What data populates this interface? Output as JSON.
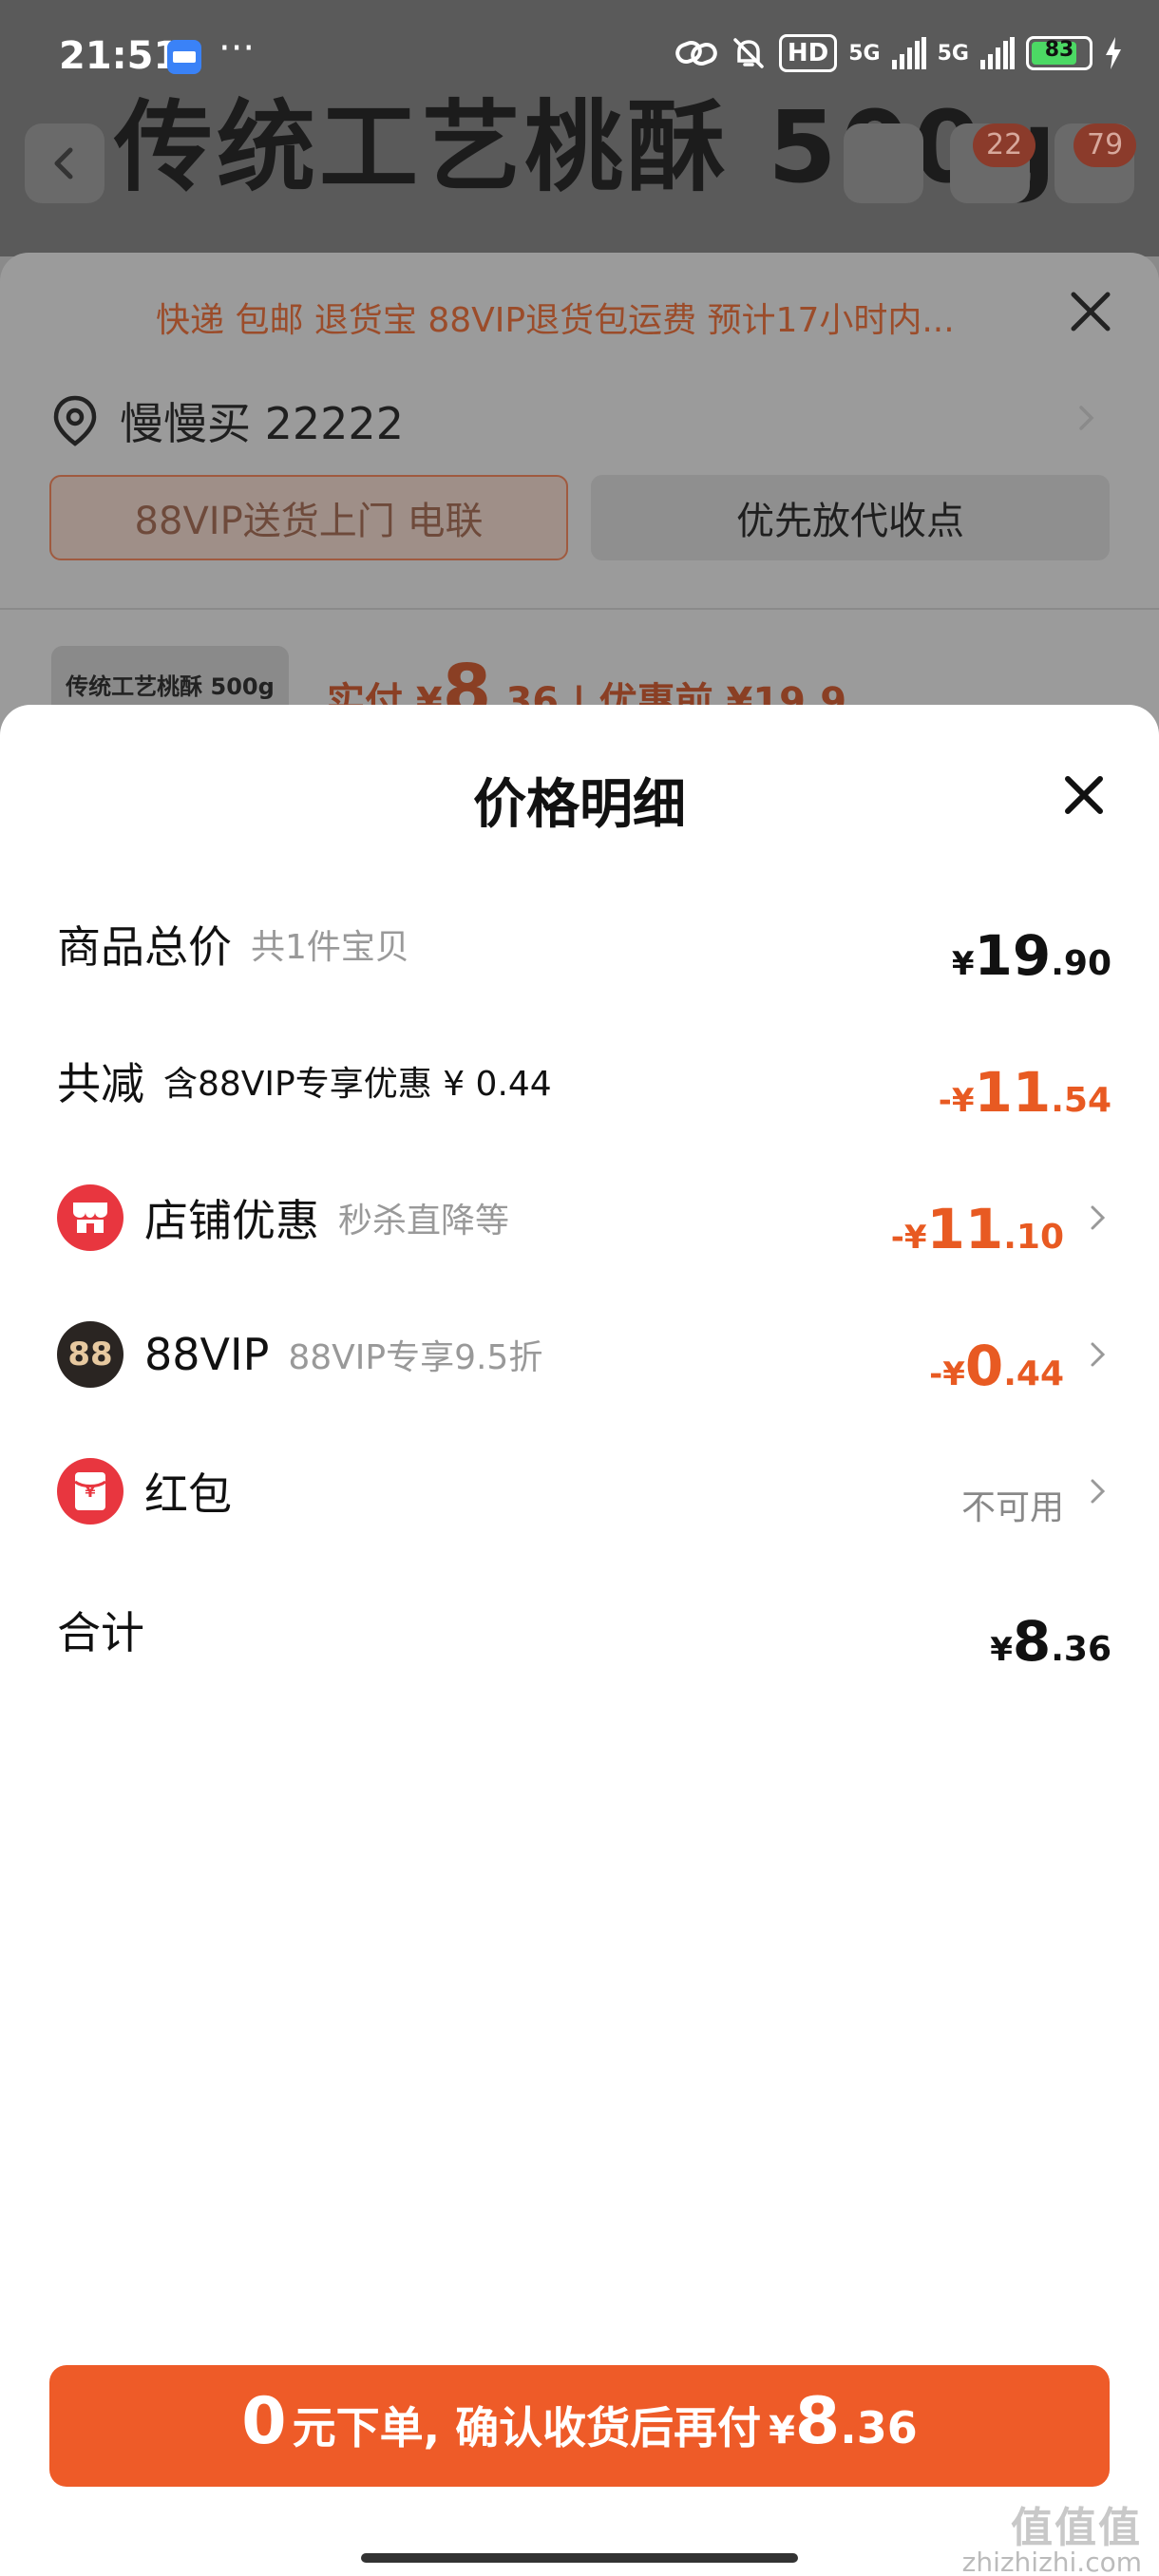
{
  "status_bar": {
    "time": "21:51",
    "dots": "···",
    "hd": "HD",
    "net1": "5G",
    "net2": "5G",
    "battery": "83",
    "battery_level": 0.83
  },
  "background": {
    "product_title": "传统工艺桃酥 500g",
    "badge_1": "22",
    "badge_2": "79",
    "notice": "快递 包邮 退货宝 88VIP退货包运费 预计17小时内...",
    "address": "慢慢买 22222",
    "option_delivery": "88VIP送货上门 电联",
    "option_pickup": "优先放代收点",
    "product_chip": "传统工艺桃酥 500g",
    "price_prefix": "实付 ¥",
    "price_big": "8",
    "price_small": ".36",
    "price_before": "| 优惠前 ¥19.9"
  },
  "sheet": {
    "title": "价格明细",
    "rows": {
      "total": {
        "label": "商品总价",
        "sub": "共1件宝贝",
        "currency": "¥",
        "integer": "19",
        "decimal": ".90"
      },
      "discount": {
        "label": "共减",
        "sub": "含88VIP专享优惠 ¥ 0.44",
        "currency": "-¥",
        "integer": "11",
        "decimal": ".54"
      },
      "store": {
        "label": "店铺优惠",
        "sub": "秒杀直降等",
        "currency": "-¥",
        "integer": "11",
        "decimal": ".10"
      },
      "vip": {
        "label": "88VIP",
        "sub": "88VIP专享9.5折",
        "icon_text": "88",
        "currency": "-¥",
        "integer": "0",
        "decimal": ".44"
      },
      "redpacket": {
        "label": "红包",
        "icon_text": "¥",
        "value": "不可用"
      },
      "sum": {
        "label": "合计",
        "currency": "¥",
        "integer": "8",
        "decimal": ".36"
      }
    }
  },
  "cta": {
    "zero": "0",
    "text": "元下单, 确认收货后再付",
    "currency": "¥",
    "integer": "8",
    "decimal": ".36"
  },
  "watermark": {
    "main": "值值值",
    "sub": "zhizhizhi.com"
  },
  "colors": {
    "accent": "#ee5b28",
    "discount": "#e85a22",
    "store_icon": "#e8363f",
    "vip_icon": "#2a2522",
    "redpacket_icon": "#e8363f"
  }
}
